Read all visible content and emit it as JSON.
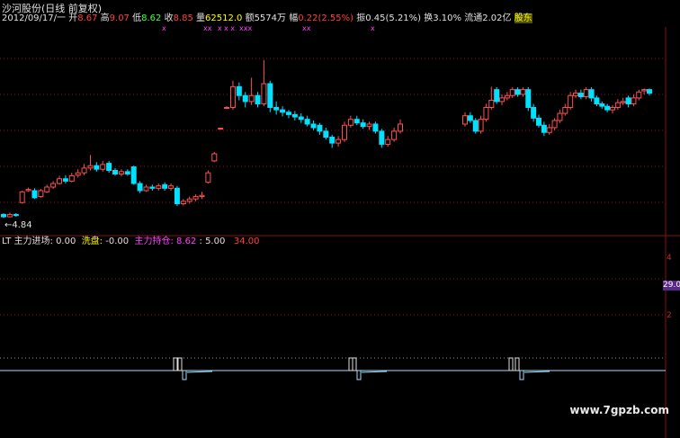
{
  "colors": {
    "up": "#ff5050",
    "down": "#00e0ff",
    "grid": "#8a1010",
    "baseline": "#a0e0ff",
    "label_white": "#e0e0e0",
    "label_yellow": "#ffff00",
    "label_magenta": "#ff40ff",
    "label_green": "#40ff40",
    "label_red": "#ff4040"
  },
  "header": {
    "stock_name": "沙河股份(日线 前复权)",
    "date": "2012/09/17/一",
    "open_label": "开",
    "open_value": "8.67",
    "high_label": "高",
    "high_value": "9.07",
    "low_label": "低",
    "low_value": "8.62",
    "close_label": "收",
    "close_value": "8.85",
    "volume_label": "量",
    "volume_value": "62512.0",
    "amount_label": "额",
    "amount_value": "5574万",
    "change_label": "幅",
    "change_value": "0.22(2.55%)",
    "swing_label": "振",
    "swing_value": "0.45(5.21%)",
    "turnover_label": "换",
    "turnover_value": "3.10%",
    "float_label": "流通",
    "float_value": "2.02亿",
    "extra_label": "股东"
  },
  "marker_row": [
    "x",
    "xx",
    "x",
    "x x",
    "xxx",
    "xx",
    "x"
  ],
  "price_chart": {
    "low_marker": "4.84",
    "candles": [
      {
        "o": 4.9,
        "c": 4.86,
        "h": 4.92,
        "l": 4.84
      },
      {
        "o": 4.86,
        "c": 4.9,
        "h": 4.93,
        "l": 4.85
      },
      {
        "o": 4.9,
        "c": 4.88,
        "h": 4.92,
        "l": 4.86
      },
      {
        "o": 5.1,
        "c": 5.28,
        "h": 5.3,
        "l": 5.08
      },
      {
        "o": 5.3,
        "c": 5.32,
        "h": 5.35,
        "l": 5.28
      },
      {
        "o": 5.3,
        "c": 5.18,
        "h": 5.34,
        "l": 5.16
      },
      {
        "o": 5.2,
        "c": 5.3,
        "h": 5.33,
        "l": 5.18
      },
      {
        "o": 5.28,
        "c": 5.36,
        "h": 5.4,
        "l": 5.26
      },
      {
        "o": 5.36,
        "c": 5.42,
        "h": 5.46,
        "l": 5.33
      },
      {
        "o": 5.42,
        "c": 5.5,
        "h": 5.55,
        "l": 5.4
      },
      {
        "o": 5.5,
        "c": 5.46,
        "h": 5.56,
        "l": 5.42
      },
      {
        "o": 5.46,
        "c": 5.55,
        "h": 5.6,
        "l": 5.44
      },
      {
        "o": 5.56,
        "c": 5.6,
        "h": 5.66,
        "l": 5.52
      },
      {
        "o": 5.6,
        "c": 5.68,
        "h": 5.75,
        "l": 5.56
      },
      {
        "o": 5.68,
        "c": 5.72,
        "h": 5.9,
        "l": 5.64
      },
      {
        "o": 5.72,
        "c": 5.66,
        "h": 5.78,
        "l": 5.62
      },
      {
        "o": 5.66,
        "c": 5.74,
        "h": 5.8,
        "l": 5.62
      },
      {
        "o": 5.76,
        "c": 5.64,
        "h": 5.8,
        "l": 5.6
      },
      {
        "o": 5.64,
        "c": 5.58,
        "h": 5.68,
        "l": 5.55
      },
      {
        "o": 5.58,
        "c": 5.62,
        "h": 5.66,
        "l": 5.54
      },
      {
        "o": 5.62,
        "c": 5.58,
        "h": 5.66,
        "l": 5.55
      },
      {
        "o": 5.7,
        "c": 5.42,
        "h": 5.72,
        "l": 5.4
      },
      {
        "o": 5.42,
        "c": 5.3,
        "h": 5.46,
        "l": 5.26
      },
      {
        "o": 5.3,
        "c": 5.36,
        "h": 5.4,
        "l": 5.28
      },
      {
        "o": 5.36,
        "c": 5.34,
        "h": 5.4,
        "l": 5.3
      },
      {
        "o": 5.34,
        "c": 5.38,
        "h": 5.42,
        "l": 5.3
      },
      {
        "o": 5.4,
        "c": 5.34,
        "h": 5.44,
        "l": 5.3
      },
      {
        "o": 5.34,
        "c": 5.38,
        "h": 5.42,
        "l": 5.3
      },
      {
        "o": 5.34,
        "c": 5.08,
        "h": 5.38,
        "l": 5.04
      },
      {
        "o": 5.08,
        "c": 5.12,
        "h": 5.16,
        "l": 5.05
      },
      {
        "o": 5.12,
        "c": 5.16,
        "h": 5.2,
        "l": 5.08
      },
      {
        "o": 5.16,
        "c": 5.2,
        "h": 5.24,
        "l": 5.12
      },
      {
        "o": 5.2,
        "c": 5.22,
        "h": 5.28,
        "l": 5.16
      },
      {
        "o": 5.44,
        "c": 5.6,
        "h": 5.64,
        "l": 5.42
      },
      {
        "o": 5.8,
        "c": 5.92,
        "h": 5.95,
        "l": 5.78
      },
      {
        "o": 6.35,
        "c": 6.35,
        "h": 6.36,
        "l": 6.34
      },
      {
        "o": 6.7,
        "c": 6.7,
        "h": 6.72,
        "l": 6.68
      },
      {
        "o": 6.7,
        "c": 7.05,
        "h": 7.15,
        "l": 6.66
      },
      {
        "o": 7.05,
        "c": 6.9,
        "h": 7.12,
        "l": 6.82
      },
      {
        "o": 6.9,
        "c": 6.8,
        "h": 6.96,
        "l": 6.7
      },
      {
        "o": 6.8,
        "c": 6.9,
        "h": 7.2,
        "l": 6.74
      },
      {
        "o": 6.9,
        "c": 6.76,
        "h": 6.96,
        "l": 6.7
      },
      {
        "o": 6.76,
        "c": 7.1,
        "h": 7.5,
        "l": 6.72
      },
      {
        "o": 7.1,
        "c": 6.7,
        "h": 7.15,
        "l": 6.62
      },
      {
        "o": 6.7,
        "c": 6.66,
        "h": 6.8,
        "l": 6.58
      },
      {
        "o": 6.66,
        "c": 6.62,
        "h": 6.72,
        "l": 6.55
      },
      {
        "o": 6.62,
        "c": 6.58,
        "h": 6.66,
        "l": 6.52
      },
      {
        "o": 6.58,
        "c": 6.54,
        "h": 6.64,
        "l": 6.48
      },
      {
        "o": 6.54,
        "c": 6.5,
        "h": 6.6,
        "l": 6.44
      },
      {
        "o": 6.5,
        "c": 6.42,
        "h": 6.56,
        "l": 6.38
      },
      {
        "o": 6.42,
        "c": 6.36,
        "h": 6.48,
        "l": 6.32
      },
      {
        "o": 6.4,
        "c": 6.3,
        "h": 6.44,
        "l": 6.24
      },
      {
        "o": 6.3,
        "c": 6.2,
        "h": 6.36,
        "l": 6.16
      },
      {
        "o": 6.2,
        "c": 6.1,
        "h": 6.24,
        "l": 6.02
      },
      {
        "o": 6.1,
        "c": 6.16,
        "h": 6.22,
        "l": 6.04
      },
      {
        "o": 6.16,
        "c": 6.4,
        "h": 6.46,
        "l": 6.12
      },
      {
        "o": 6.4,
        "c": 6.5,
        "h": 6.56,
        "l": 6.36
      },
      {
        "o": 6.5,
        "c": 6.44,
        "h": 6.56,
        "l": 6.4
      },
      {
        "o": 6.44,
        "c": 6.38,
        "h": 6.5,
        "l": 6.34
      },
      {
        "o": 6.38,
        "c": 6.42,
        "h": 6.46,
        "l": 6.32
      },
      {
        "o": 6.42,
        "c": 6.3,
        "h": 6.46,
        "l": 6.26
      },
      {
        "o": 6.3,
        "c": 6.08,
        "h": 6.34,
        "l": 6.02
      },
      {
        "o": 6.08,
        "c": 6.16,
        "h": 6.22,
        "l": 6.04
      },
      {
        "o": 6.16,
        "c": 6.3,
        "h": 6.36,
        "l": 6.12
      },
      {
        "o": 6.3,
        "c": 6.42,
        "h": 6.5,
        "l": 6.26
      },
      {
        "o": 6.42,
        "c": 6.56,
        "h": 6.62,
        "l": 6.38
      },
      {
        "o": 6.56,
        "c": 6.48,
        "h": 6.62,
        "l": 6.44
      },
      {
        "o": 6.48,
        "c": 6.3,
        "h": 6.52,
        "l": 6.26
      },
      {
        "o": 6.3,
        "c": 6.5,
        "h": 6.56,
        "l": 6.26
      },
      {
        "o": 6.5,
        "c": 6.7,
        "h": 6.76,
        "l": 6.46
      },
      {
        "o": 6.7,
        "c": 6.82,
        "h": 7.05,
        "l": 6.66
      },
      {
        "o": 7.0,
        "c": 6.8,
        "h": 7.04,
        "l": 6.76
      },
      {
        "o": 6.8,
        "c": 6.86,
        "h": 6.92,
        "l": 6.74
      },
      {
        "o": 6.86,
        "c": 6.9,
        "h": 6.96,
        "l": 6.82
      },
      {
        "o": 6.9,
        "c": 7.0,
        "h": 7.04,
        "l": 6.86
      },
      {
        "o": 7.0,
        "c": 6.92,
        "h": 7.04,
        "l": 6.88
      },
      {
        "o": 6.92,
        "c": 7.0,
        "h": 7.04,
        "l": 6.88
      },
      {
        "o": 7.0,
        "c": 6.7,
        "h": 7.04,
        "l": 6.64
      },
      {
        "o": 6.7,
        "c": 6.52,
        "h": 6.76,
        "l": 6.46
      },
      {
        "o": 6.52,
        "c": 6.4,
        "h": 6.58,
        "l": 6.36
      },
      {
        "o": 6.4,
        "c": 6.28,
        "h": 6.46,
        "l": 6.22
      },
      {
        "o": 6.28,
        "c": 6.36,
        "h": 6.42,
        "l": 6.24
      },
      {
        "o": 6.36,
        "c": 6.48,
        "h": 6.52,
        "l": 6.32
      },
      {
        "o": 6.48,
        "c": 6.6,
        "h": 6.66,
        "l": 6.44
      },
      {
        "o": 6.6,
        "c": 6.7,
        "h": 6.76,
        "l": 6.56
      },
      {
        "o": 6.7,
        "c": 6.9,
        "h": 6.96,
        "l": 6.66
      },
      {
        "o": 6.9,
        "c": 6.94,
        "h": 7.0,
        "l": 6.86
      },
      {
        "o": 6.94,
        "c": 6.88,
        "h": 7.0,
        "l": 6.84
      },
      {
        "o": 6.88,
        "c": 7.0,
        "h": 7.04,
        "l": 6.84
      },
      {
        "o": 7.0,
        "c": 6.86,
        "h": 7.04,
        "l": 6.8
      },
      {
        "o": 6.86,
        "c": 6.76,
        "h": 6.9,
        "l": 6.72
      },
      {
        "o": 6.76,
        "c": 6.72,
        "h": 6.8,
        "l": 6.68
      },
      {
        "o": 6.72,
        "c": 6.66,
        "h": 6.76,
        "l": 6.62
      },
      {
        "o": 6.66,
        "c": 6.7,
        "h": 6.74,
        "l": 6.6
      },
      {
        "o": 6.7,
        "c": 6.78,
        "h": 6.84,
        "l": 6.66
      },
      {
        "o": 6.78,
        "c": 6.8,
        "h": 6.86,
        "l": 6.74
      },
      {
        "o": 6.86,
        "c": 6.76,
        "h": 6.9,
        "l": 6.7
      },
      {
        "o": 6.76,
        "c": 6.86,
        "h": 6.92,
        "l": 6.72
      },
      {
        "o": 6.86,
        "c": 6.96,
        "h": 7.0,
        "l": 6.82
      },
      {
        "o": 6.98,
        "c": 7.0,
        "h": 7.02,
        "l": 6.92
      },
      {
        "o": 7.0,
        "c": 6.94,
        "h": 7.02,
        "l": 6.9
      }
    ]
  },
  "indicator": {
    "prefix": "LT",
    "label1": "主力进场:",
    "value1": "0.00",
    "label2": "洗盘:",
    "value2": "-0.00",
    "label3": "主力持仓:",
    "value3": "8.62",
    "sep": ":",
    "value4": "5.00",
    "value5": "34.00",
    "tag_value": "29.0",
    "axis_ticks": [
      "4",
      "2"
    ]
  },
  "watermark": "www.7gpzb.com"
}
